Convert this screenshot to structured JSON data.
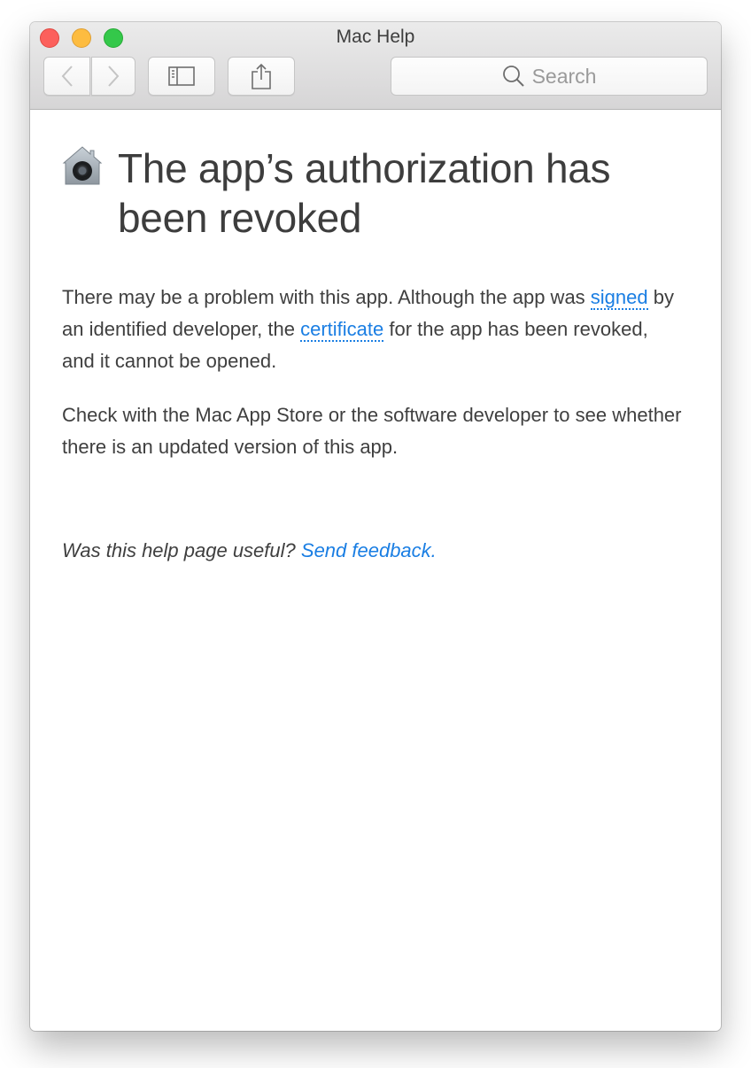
{
  "window": {
    "title": "Mac Help",
    "traffic_lights": [
      "close",
      "minimize",
      "zoom"
    ]
  },
  "toolbar": {
    "back_icon": "chevron-left-icon",
    "forward_icon": "chevron-right-icon",
    "sidebar_icon": "sidebar-icon",
    "share_icon": "share-icon",
    "search_placeholder": "Search"
  },
  "article": {
    "icon": "gatekeeper-house-icon",
    "title": "The app’s authorization has been revoked",
    "paragraph1": {
      "before_link1": "There may be a problem with this app. Although the app was ",
      "link1": "signed",
      "between_links": " by an identified developer, the ",
      "link2": "certificate",
      "after_link2": " for the app has been revoked, and it cannot be opened."
    },
    "paragraph2": "Check with the Mac App Store or the software developer to see whether there is an updated version of this app.",
    "feedback": {
      "question": "Was this help page useful? ",
      "link": "Send feedback."
    }
  },
  "colors": {
    "link": "#1a7ee3",
    "text": "#3f3f3f",
    "close": "#fc605c",
    "minimize": "#fdbc40",
    "zoom": "#34c84a"
  }
}
